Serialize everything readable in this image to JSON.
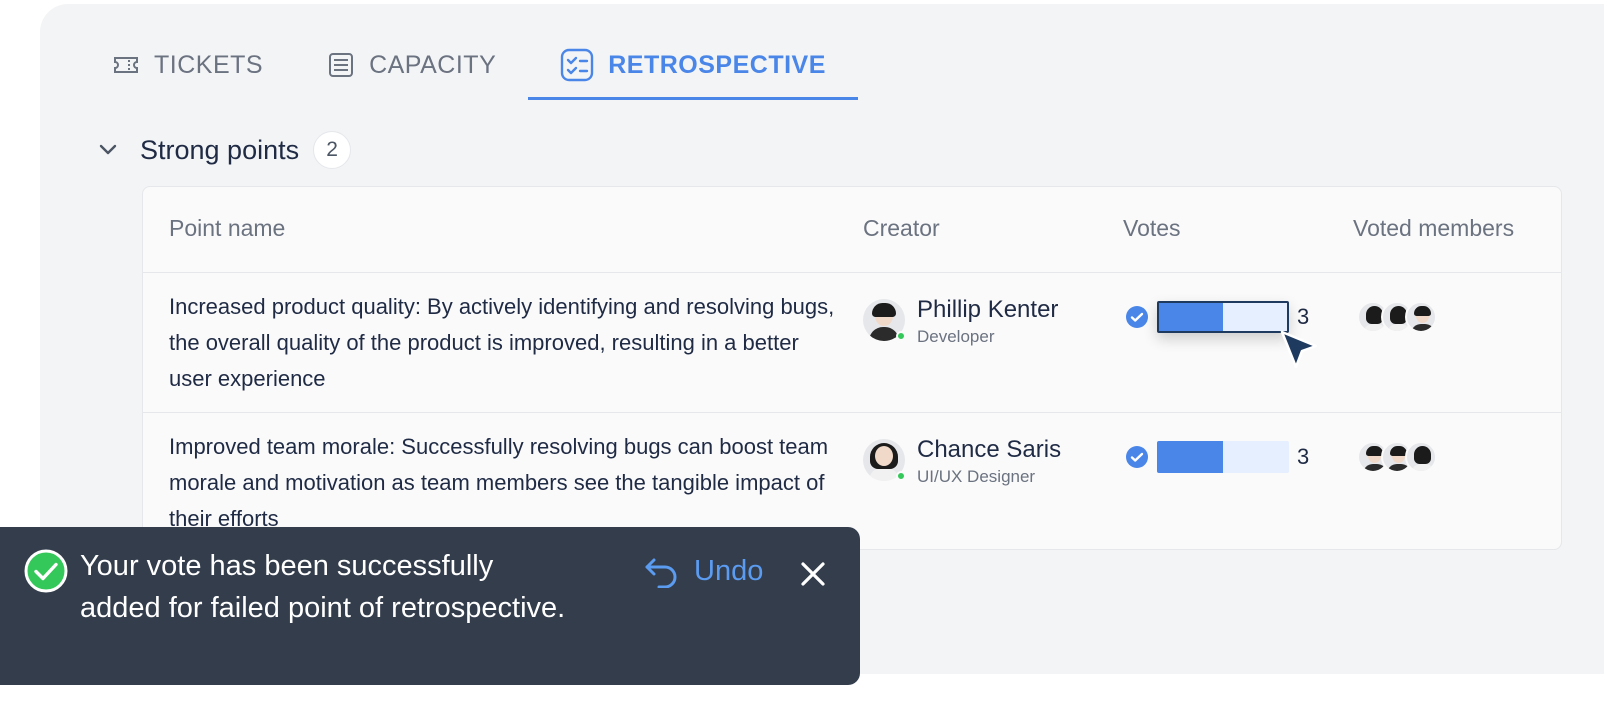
{
  "tabs": [
    {
      "label": "TICKETS",
      "icon": "ticket-icon",
      "active": false
    },
    {
      "label": "CAPACITY",
      "icon": "list-icon",
      "active": false
    },
    {
      "label": "RETROSPECTIVE",
      "icon": "checklist-icon",
      "active": true
    }
  ],
  "section": {
    "title": "Strong points",
    "count": "2"
  },
  "table": {
    "headers": {
      "point": "Point name",
      "creator": "Creator",
      "votes": "Votes",
      "members": "Voted members"
    },
    "rows": [
      {
        "point": "Increased product quality: By actively identifying and resolving bugs, the overall quality of the product is improved, resulting in a better user experience",
        "creator_name": "Phillip Kenter",
        "creator_role": "Developer",
        "votes": "3",
        "vote_fraction": 0.5
      },
      {
        "point": "Improved team morale: Successfully resolving bugs can boost team morale and motivation as team members see the tangible impact of their efforts",
        "creator_name": "Chance Saris",
        "creator_role": "UI/UX Designer",
        "votes": "3",
        "vote_fraction": 0.5
      }
    ]
  },
  "toast": {
    "message": "Your vote has been successfully added for failed point of retrospective.",
    "undo_label": "Undo"
  },
  "colors": {
    "accent": "#4a86e8",
    "toast_bg": "#333d4c",
    "success": "#34c759"
  }
}
